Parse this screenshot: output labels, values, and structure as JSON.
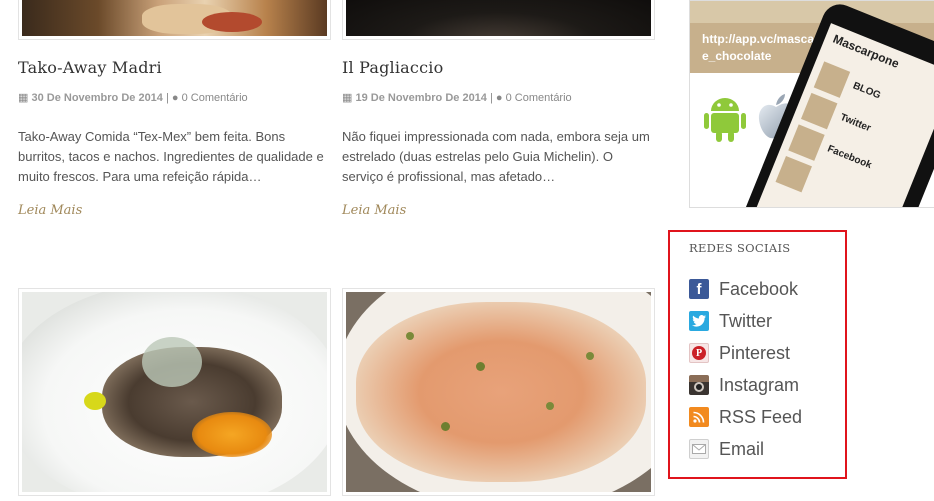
{
  "posts": [
    {
      "title": "Tako-Away Madri",
      "date": "30 De Novembro De 2014",
      "comments": "0 Comentário",
      "excerpt": "Tako-Away  Comida “Tex-Mex” bem feita. Bons burritos, tacos e nachos. Ingredientes de qualidade e muito frescos. Para uma refeição rápida…",
      "read_more": "Leia Mais"
    },
    {
      "title": "Il Pagliaccio",
      "date": "19 De Novembro De 2014",
      "comments": "0 Comentário",
      "excerpt": "Não fiquei impressionada com nada, embora seja um estrelado (duas estrelas pelo Guia Michelin). O serviço é profissional, mas afetado…",
      "read_more": "Leia Mais"
    }
  ],
  "meta_separator": "|",
  "promo": {
    "url_text": "http://app.vc/mascarpone_e_chocolate",
    "url_line1": "http://app.vc/mascarpone_",
    "url_line2": "e_chocolate",
    "phone_title": "Mascarpone",
    "phone_items": [
      "BLOG",
      "Twitter",
      "Facebook"
    ],
    "platforms": [
      "android-icon",
      "apple-icon"
    ]
  },
  "social_widget": {
    "title": "REDES SOCIAIS",
    "items": [
      {
        "label": "Facebook",
        "icon": "facebook-icon",
        "color": "#3b5998",
        "glyph": "f"
      },
      {
        "label": "Twitter",
        "icon": "twitter-icon",
        "color": "#2aa9e0",
        "glyph": "t"
      },
      {
        "label": "Pinterest",
        "icon": "pinterest-icon",
        "color": "#cb2027",
        "glyph": "P"
      },
      {
        "label": "Instagram",
        "icon": "instagram-icon",
        "color": "#6b5546",
        "glyph": "◉"
      },
      {
        "label": "RSS Feed",
        "icon": "rss-icon",
        "color": "#f28a1f",
        "glyph": ")"
      },
      {
        "label": "Email",
        "icon": "email-icon",
        "color": "#cfcfcf",
        "glyph": "✉"
      }
    ],
    "highlight_color": "#e0141c"
  },
  "colors": {
    "read_more": "#a0885a",
    "promo_band": "#c7b08c"
  }
}
